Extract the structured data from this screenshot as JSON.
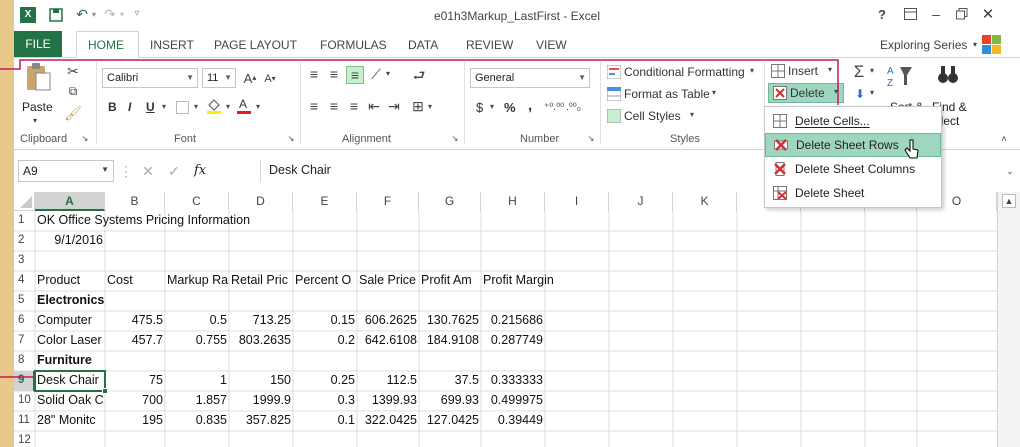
{
  "window": {
    "title": "e01h3Markup_LastFirst - Excel",
    "app_icon": "excel-icon",
    "controls": [
      "?",
      "restore-ribbon-icon",
      "–",
      "□",
      "✕"
    ]
  },
  "tabs": {
    "file": "FILE",
    "items": [
      "HOME",
      "INSERT",
      "PAGE LAYOUT",
      "FORMULAS",
      "DATA",
      "REVIEW",
      "VIEW"
    ],
    "active": "HOME",
    "account": "Exploring Series"
  },
  "ribbon": {
    "clipboard": {
      "paste": "Paste",
      "label": "Clipboard"
    },
    "font": {
      "name": "Calibri",
      "size": "11",
      "bold": "B",
      "italic": "I",
      "underline": "U",
      "label": "Font"
    },
    "alignment": {
      "label": "Alignment"
    },
    "number": {
      "format": "General",
      "currency": "$",
      "percent": "%",
      "comma": ",",
      "inc": "⁺⁰.⁰⁰",
      "dec": ".⁰⁰₀",
      "label": "Number"
    },
    "styles": {
      "conditional": "Conditional Formatting",
      "format_table": "Format as Table",
      "cell_styles": "Cell Styles",
      "label": "Styles"
    },
    "cells": {
      "insert": "Insert",
      "delete": "Delete"
    },
    "editing": {
      "sort": "Sort &",
      "find": "Find &",
      "select": "elect"
    }
  },
  "formula_bar": {
    "name_box": "A9",
    "fx": "fx",
    "content": "Desk Chair"
  },
  "delete_menu": {
    "items": [
      {
        "label": "Delete Cells...",
        "icon": "delete-cells-icon"
      },
      {
        "label": "Delete Sheet Rows",
        "icon": "delete-rows-icon"
      },
      {
        "label": "Delete Sheet Columns",
        "icon": "delete-columns-icon"
      },
      {
        "label": "Delete Sheet",
        "icon": "delete-sheet-icon"
      }
    ],
    "highlighted": 1
  },
  "grid": {
    "columns": [
      "A",
      "B",
      "C",
      "D",
      "E",
      "F",
      "G",
      "H",
      "I",
      "J",
      "K",
      "L",
      "O"
    ],
    "rows": [
      "1",
      "2",
      "3",
      "4",
      "5",
      "6",
      "7",
      "8",
      "9",
      "10",
      "11",
      "12"
    ],
    "selected_cell": "A9",
    "cells": {
      "r1": "OK Office Systems Pricing Information",
      "r2": "9/1/2016",
      "r4": [
        "Product",
        "Cost",
        "Markup Ra",
        "Retail Pric",
        "Percent O",
        "Sale Price",
        "Profit Am",
        "Profit Margin"
      ],
      "r5": "Electronics",
      "r6": [
        "Computer",
        "475.5",
        "0.5",
        "713.25",
        "0.15",
        "606.2625",
        "130.7625",
        "0.215686"
      ],
      "r7": [
        "Color Laser",
        "457.7",
        "0.755",
        "803.2635",
        "0.2",
        "642.6108",
        "184.9108",
        "0.287749"
      ],
      "r8": "Furniture",
      "r9": [
        "Desk Chair",
        "75",
        "1",
        "150",
        "0.25",
        "112.5",
        "37.5",
        "0.333333"
      ],
      "r10": [
        "Solid Oak C",
        "700",
        "1.857",
        "1999.9",
        "0.3",
        "1399.93",
        "699.93",
        "0.499975"
      ],
      "r11": [
        "28\" Monitc",
        "195",
        "0.835",
        "357.825",
        "0.1",
        "322.0425",
        "127.0425",
        "0.39449"
      ]
    }
  },
  "colors": {
    "excel_green": "#217346",
    "highlight": "#9fd6c0",
    "annotation": "#c2185b",
    "background": "#e9c98a"
  }
}
